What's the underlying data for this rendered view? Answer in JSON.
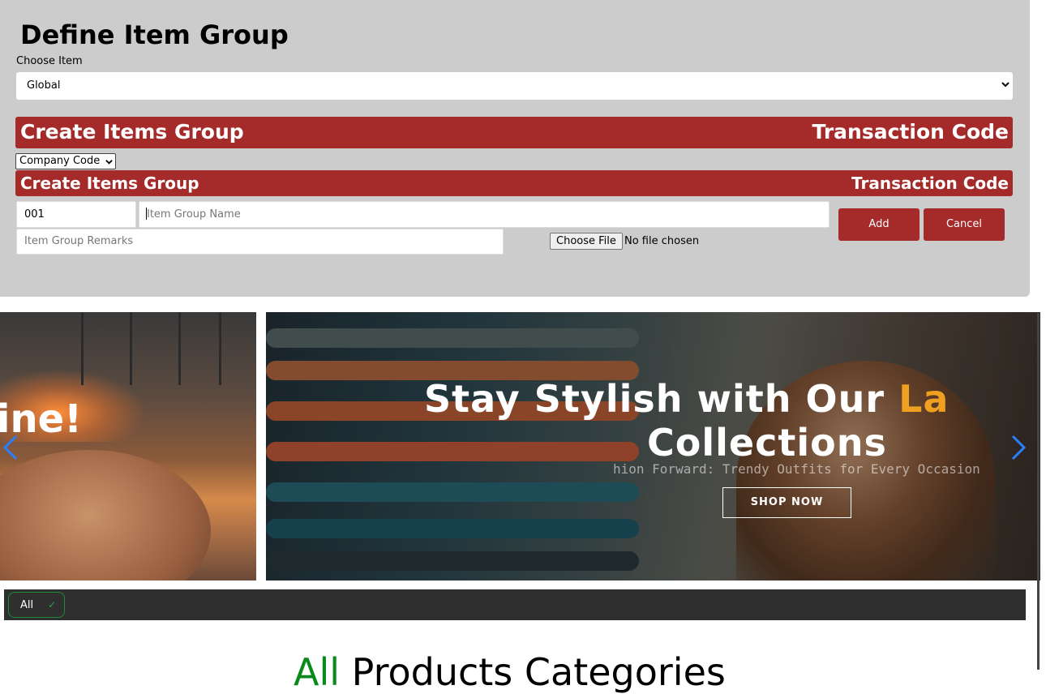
{
  "form": {
    "title": "Define Item Group",
    "choose_label": "Choose Item",
    "choose_value": "Global",
    "bar1_left": "Create Items Group",
    "bar1_right": "Transaction Code",
    "company_select": "Company Code",
    "bar2_left": "Create Items Group",
    "bar2_right": "Transaction Code",
    "code_value": "001",
    "name_placeholder": "Item Group Name",
    "remarks_placeholder": "Item Group Remarks",
    "file_button": "Choose File",
    "file_status": "No file chosen",
    "add_label": "Add",
    "cancel_label": "Cancel"
  },
  "carousel": {
    "left_slide_text": "ine!",
    "headline_prefix": "Stay Stylish with Our ",
    "headline_accent": "La",
    "headline_line2": "Collections",
    "subtitle": "hion Forward: Trendy Outfits for Every Occasion",
    "cta": "SHOP NOW",
    "accent_color": "#f0a020"
  },
  "filter": {
    "chip_label": "All",
    "chip_check": "✓"
  },
  "section": {
    "heading_accent": "All",
    "heading_rest": " Products Categories"
  },
  "colors": {
    "brand_red": "#a52a2a",
    "panel_gray": "#cccccc",
    "green": "#0a8a1a"
  },
  "icons": {
    "select_chevron": "chevron-down-icon",
    "prev": "chevron-left-icon",
    "next": "chevron-right-icon",
    "check": "check-icon"
  }
}
